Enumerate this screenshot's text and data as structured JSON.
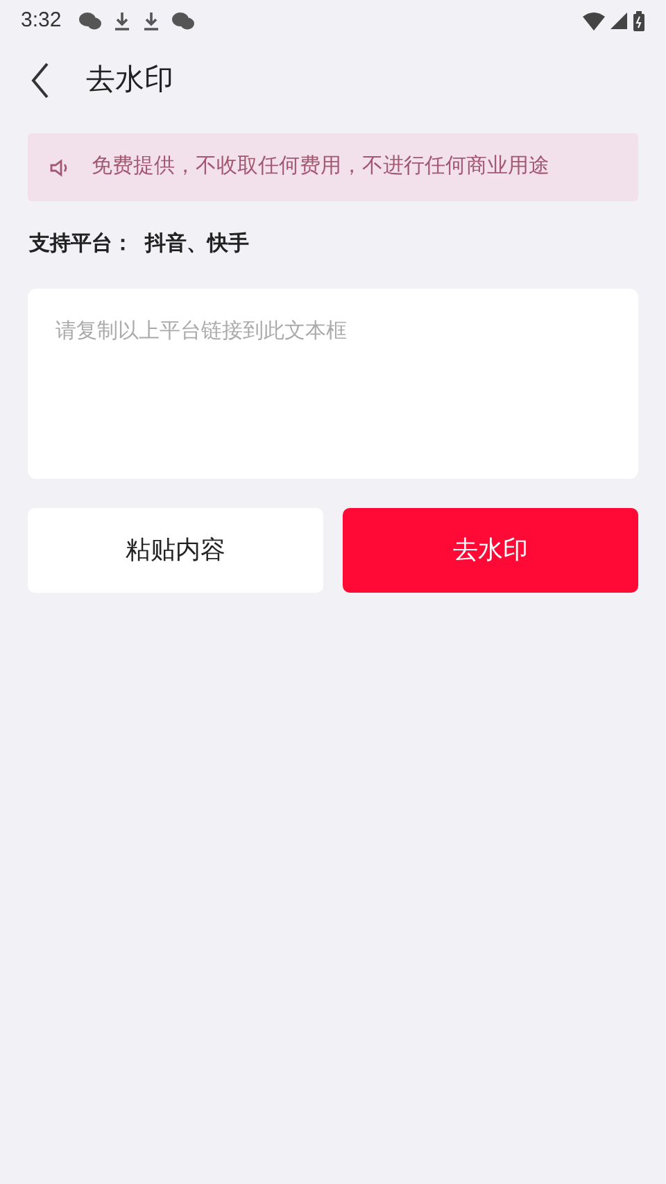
{
  "status_bar": {
    "time": "3:32"
  },
  "header": {
    "title": "去水印"
  },
  "notice": {
    "text": "免费提供，不收取任何费用，不进行任何商业用途"
  },
  "platforms": {
    "text": "支持平台：  抖音、快手"
  },
  "link_field": {
    "placeholder": "请复制以上平台链接到此文本框"
  },
  "buttons": [
    {
      "label": "粘贴内容",
      "kind": "secondary"
    },
    {
      "label": "去水印",
      "kind": "primary"
    }
  ]
}
